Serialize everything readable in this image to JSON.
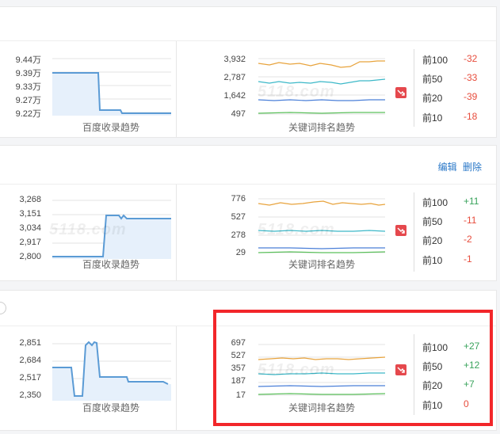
{
  "colors": {
    "baidu_line": "#5b9bd5",
    "kw_top100": "#e8a33c",
    "kw_top50": "#3cb8c8",
    "kw_top20": "#4a7fd8",
    "kw_top10": "#5cc05c",
    "neg": "#e74c3c",
    "pos": "#3aa35c",
    "highlight": "#f2262a",
    "link": "#2a78c8"
  },
  "watermark": "5118.com",
  "rows": [
    {
      "baidu": {
        "caption": "百度收录趋势",
        "axis": [
          "9.44万",
          "9.39万",
          "9.33万",
          "9.27万",
          "9.22万"
        ],
        "trend_icon": "none"
      },
      "keywords": {
        "caption": "关键词排名趋势",
        "axis": [
          "3,932",
          "2,787",
          "1,642",
          "497"
        ],
        "trend_icon": "down-trend-icon"
      },
      "ranks": [
        {
          "label": "前100",
          "value": "-32"
        },
        {
          "label": "前50",
          "value": "-33"
        },
        {
          "label": "前20",
          "value": "-39"
        },
        {
          "label": "前10",
          "value": "-18"
        }
      ]
    },
    {
      "actions": {
        "edit": "编辑",
        "delete": "删除"
      },
      "baidu": {
        "caption": "百度收录趋势",
        "axis": [
          "3,268",
          "3,151",
          "3,034",
          "2,917",
          "2,800"
        ]
      },
      "keywords": {
        "caption": "关键词排名趋势",
        "axis": [
          "776",
          "527",
          "278",
          "29"
        ]
      },
      "ranks": [
        {
          "label": "前100",
          "value": "+11"
        },
        {
          "label": "前50",
          "value": "-11"
        },
        {
          "label": "前20",
          "value": "-2"
        },
        {
          "label": "前10",
          "value": "-1"
        }
      ]
    },
    {
      "baidu": {
        "caption": "百度收录趋势",
        "axis": [
          "2,851",
          "2,684",
          "2,517",
          "2,350"
        ]
      },
      "keywords": {
        "caption": "关键词排名趋势",
        "axis": [
          "697",
          "527",
          "357",
          "187",
          "17"
        ]
      },
      "ranks": [
        {
          "label": "前100",
          "value": "+27"
        },
        {
          "label": "前50",
          "value": "+12"
        },
        {
          "label": "前20",
          "value": "+7"
        },
        {
          "label": "前10",
          "value": "0"
        }
      ]
    }
  ]
}
